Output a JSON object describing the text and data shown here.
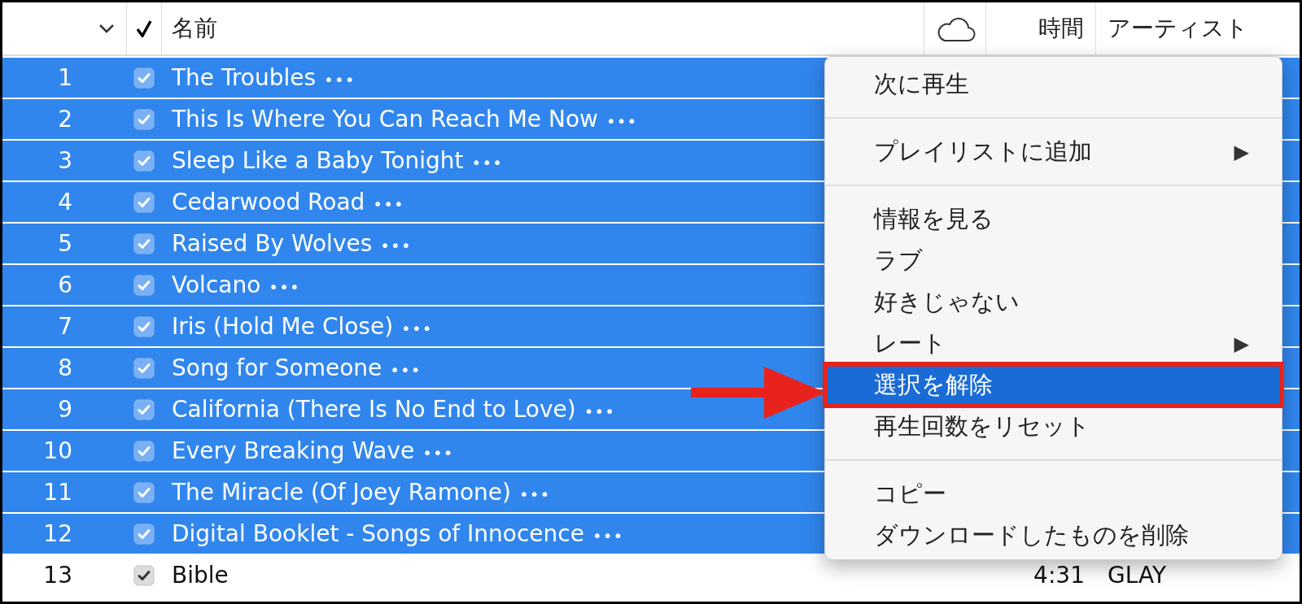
{
  "header": {
    "columns": [
      {
        "label": "名前"
      },
      {
        "label": "時間"
      },
      {
        "label": "アーティスト"
      }
    ]
  },
  "tracks": [
    {
      "number": "1",
      "checked": true,
      "name": "The Troubles",
      "more": "•••",
      "selected": true
    },
    {
      "number": "2",
      "checked": true,
      "name": "This Is Where You Can Reach Me Now",
      "more": "•••",
      "selected": true
    },
    {
      "number": "3",
      "checked": true,
      "name": "Sleep Like a Baby Tonight",
      "more": "•••",
      "selected": true
    },
    {
      "number": "4",
      "checked": true,
      "name": "Cedarwood Road",
      "more": "•••",
      "selected": true
    },
    {
      "number": "5",
      "checked": true,
      "name": "Raised By Wolves",
      "more": "•••",
      "selected": true
    },
    {
      "number": "6",
      "checked": true,
      "name": "Volcano",
      "more": "•••",
      "selected": true
    },
    {
      "number": "7",
      "checked": true,
      "name": "Iris (Hold Me Close)",
      "more": "•••",
      "selected": true
    },
    {
      "number": "8",
      "checked": true,
      "name": "Song for Someone",
      "more": "•••",
      "selected": true
    },
    {
      "number": "9",
      "checked": true,
      "name": "California (There Is No End to Love)",
      "more": "•••",
      "selected": true
    },
    {
      "number": "10",
      "checked": true,
      "name": "Every Breaking Wave",
      "more": "•••",
      "selected": true
    },
    {
      "number": "11",
      "checked": true,
      "name": "The Miracle (Of Joey Ramone)",
      "more": "•••",
      "selected": true
    },
    {
      "number": "12",
      "checked": true,
      "name": "Digital Booklet - Songs of Innocence",
      "more": "•••",
      "selected": true
    },
    {
      "number": "13",
      "checked": true,
      "name": "Bible",
      "time": "4:31",
      "artist": "GLAY",
      "selected": false
    }
  ],
  "context_menu": {
    "items": [
      {
        "kind": "item",
        "label": "次に再生",
        "selected": false
      },
      {
        "kind": "separator"
      },
      {
        "kind": "item",
        "label": "プレイリストに追加",
        "submenu_arrow": "▶",
        "selected": false
      },
      {
        "kind": "separator"
      },
      {
        "kind": "item",
        "label": "情報を見る",
        "selected": false
      },
      {
        "kind": "item",
        "label": "ラブ",
        "selected": false
      },
      {
        "kind": "item",
        "label": "好きじゃない",
        "selected": false
      },
      {
        "kind": "item",
        "label": "レート",
        "submenu_arrow": "▶",
        "selected": false
      },
      {
        "kind": "item",
        "label": "選択を解除",
        "selected": true,
        "annotated": true
      },
      {
        "kind": "item",
        "label": "再生回数をリセット",
        "selected": false
      },
      {
        "kind": "separator"
      },
      {
        "kind": "item",
        "label": "コピー",
        "selected": false
      },
      {
        "kind": "item",
        "label": "ダウンロードしたものを削除",
        "selected": false
      }
    ]
  }
}
